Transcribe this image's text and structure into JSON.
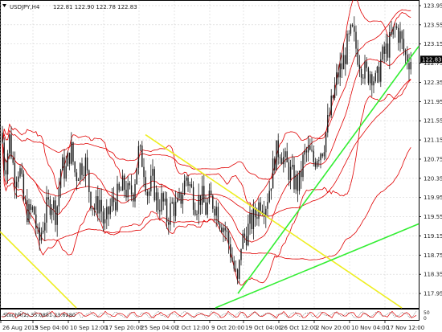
{
  "header": {
    "symbol_timeframe": "USDJPY,H4",
    "ohlc": "122.81 122.90 122.78 122.83"
  },
  "price_marker": "122.83",
  "indicator_label": "StochR(2) 35.0881 23.6280",
  "colors": {
    "candles": "#1a1a1a",
    "bands": "#e00000",
    "trend_green": "#33ee33",
    "trend_yellow": "#eeee22",
    "grid": "#d6d6d6",
    "indicator_line": "#e00000",
    "indicator_line2": "#1a1a1a"
  },
  "chart_data": {
    "type": "candlestick",
    "symbol": "USDJPY",
    "timeframe": "H4",
    "grid": true,
    "ylim": [
      117.65,
      124.05
    ],
    "y_ticks": [
      "123.95",
      "123.55",
      "123.15",
      "122.75",
      "122.35",
      "121.95",
      "121.55",
      "121.15",
      "120.75",
      "120.35",
      "119.95",
      "119.55",
      "119.15",
      "118.75",
      "118.35",
      "117.95"
    ],
    "x_ticks": [
      "26 Aug 2015",
      "3 Sep 04:00",
      "10 Sep 12:00",
      "17 Sep 20:00",
      "25 Sep 04:00",
      "2 Oct 12:00",
      "9 Oct 20:00",
      "19 Oct 04:00",
      "26 Oct 12:00",
      "2 Nov 20:00",
      "10 Nov 04:00",
      "17 Nov 12:00"
    ],
    "x_tick_positions": [
      0,
      40,
      84,
      128,
      172,
      216,
      260,
      302,
      346,
      390,
      434,
      478
    ],
    "close_anchors": [
      [
        0,
        121.7
      ],
      [
        6,
        120.5
      ],
      [
        12,
        121.2
      ],
      [
        18,
        120.4
      ],
      [
        24,
        120.6
      ],
      [
        30,
        119.8
      ],
      [
        36,
        119.6
      ],
      [
        42,
        119.7
      ],
      [
        48,
        118.95
      ],
      [
        52,
        119.3
      ],
      [
        58,
        119.7
      ],
      [
        64,
        119.9
      ],
      [
        70,
        119.6
      ],
      [
        76,
        120.6
      ],
      [
        82,
        120.5
      ],
      [
        88,
        121.0
      ],
      [
        94,
        120.4
      ],
      [
        100,
        120.6
      ],
      [
        106,
        120.7
      ],
      [
        112,
        120.0
      ],
      [
        118,
        119.7
      ],
      [
        124,
        119.9
      ],
      [
        130,
        119.3
      ],
      [
        136,
        119.7
      ],
      [
        142,
        119.9
      ],
      [
        148,
        120.0
      ],
      [
        154,
        120.2
      ],
      [
        160,
        120.0
      ],
      [
        166,
        120.1
      ],
      [
        172,
        120.9
      ],
      [
        178,
        120.7
      ],
      [
        184,
        120.0
      ],
      [
        190,
        120.3
      ],
      [
        196,
        119.8
      ],
      [
        202,
        119.9
      ],
      [
        208,
        119.5
      ],
      [
        214,
        119.8
      ],
      [
        220,
        119.7
      ],
      [
        226,
        120.0
      ],
      [
        232,
        120.4
      ],
      [
        238,
        120.1
      ],
      [
        244,
        119.8
      ],
      [
        250,
        120.0
      ],
      [
        256,
        119.7
      ],
      [
        262,
        119.9
      ],
      [
        268,
        119.8
      ],
      [
        274,
        119.5
      ],
      [
        280,
        119.3
      ],
      [
        286,
        118.9
      ],
      [
        292,
        118.4
      ],
      [
        296,
        118.1
      ],
      [
        300,
        119.0
      ],
      [
        306,
        119.2
      ],
      [
        312,
        119.4
      ],
      [
        318,
        119.6
      ],
      [
        324,
        119.9
      ],
      [
        330,
        119.8
      ],
      [
        336,
        120.2
      ],
      [
        342,
        120.8
      ],
      [
        348,
        121.0
      ],
      [
        354,
        120.7
      ],
      [
        360,
        120.5
      ],
      [
        366,
        120.3
      ],
      [
        372,
        120.2
      ],
      [
        378,
        120.8
      ],
      [
        384,
        120.9
      ],
      [
        390,
        120.7
      ],
      [
        396,
        120.9
      ],
      [
        402,
        121.0
      ],
      [
        408,
        121.5
      ],
      [
        414,
        122.0
      ],
      [
        420,
        122.5
      ],
      [
        426,
        122.7
      ],
      [
        432,
        123.1
      ],
      [
        438,
        123.4
      ],
      [
        444,
        123.0
      ],
      [
        450,
        122.7
      ],
      [
        456,
        122.5
      ],
      [
        462,
        122.6
      ],
      [
        468,
        122.3
      ],
      [
        474,
        122.8
      ],
      [
        480,
        123.0
      ],
      [
        486,
        123.2
      ],
      [
        492,
        123.5
      ],
      [
        498,
        123.3
      ],
      [
        504,
        122.9
      ],
      [
        510,
        122.83
      ]
    ],
    "trendlines": [
      {
        "color": "yellow",
        "from": [
          181,
          121.26
        ],
        "to": [
          500,
          117.65
        ]
      },
      {
        "color": "yellow",
        "from": [
          0,
          119.24
        ],
        "to": [
          95,
          117.65
        ]
      },
      {
        "color": "green",
        "from": [
          296,
          117.95
        ],
        "to": [
          521,
          123.1
        ]
      },
      {
        "color": "green",
        "from": [
          268,
          117.65
        ],
        "to": [
          521,
          119.4
        ]
      }
    ],
    "indicator": {
      "name": "StochR(2)",
      "values": [
        35.0881,
        23.628
      ]
    }
  }
}
